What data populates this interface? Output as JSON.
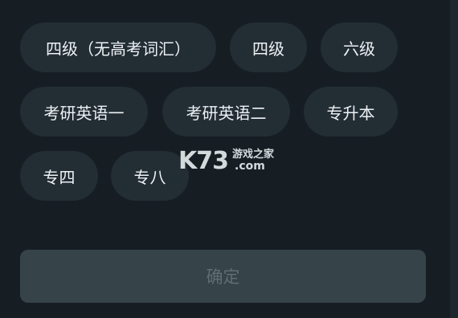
{
  "options": [
    {
      "label": "四级（无高考词汇）"
    },
    {
      "label": "四级"
    },
    {
      "label": "六级"
    },
    {
      "label": "考研英语一"
    },
    {
      "label": "考研英语二"
    },
    {
      "label": "专升本"
    },
    {
      "label": "专四"
    },
    {
      "label": "专八"
    }
  ],
  "confirm_label": "确定",
  "watermark": {
    "brand": "K73",
    "tagline": "游戏之家",
    "domain": ".com"
  }
}
